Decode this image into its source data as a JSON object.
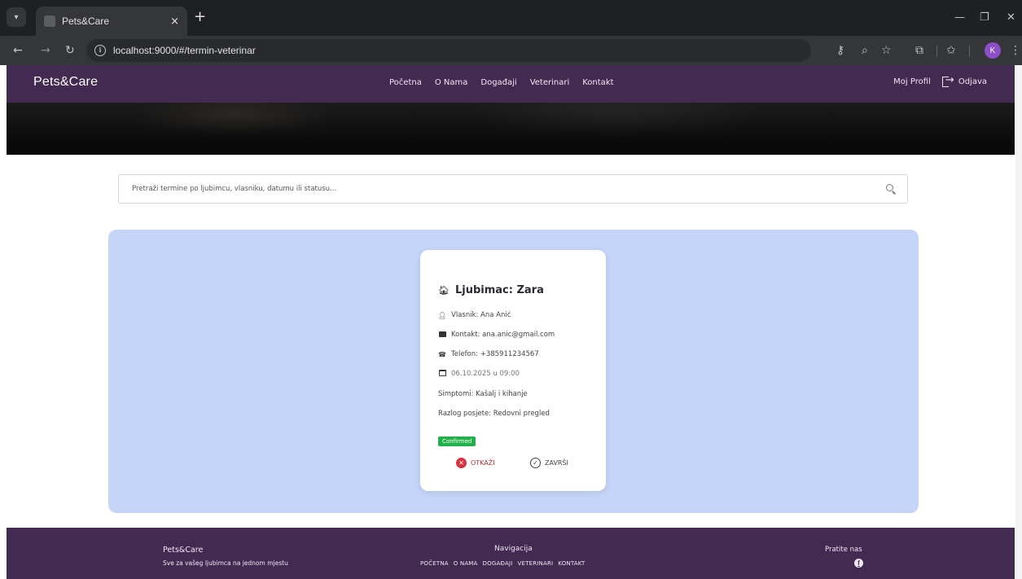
{
  "browser": {
    "tab_title": "Pets&Care",
    "tab_close": "×",
    "new_tab": "+",
    "url": "localhost:9000/#/termin-veterinar",
    "profile_initial": "K"
  },
  "header": {
    "brand": "Pets&Care",
    "nav": [
      "Početna",
      "O Nama",
      "Događaji",
      "Veterinari",
      "Kontakt"
    ],
    "profile_link": "Moj Profil",
    "logout": "Odjava"
  },
  "search": {
    "placeholder": "Pretraži termine po ljubimcu, vlasniku, datumu ili statusu..."
  },
  "appointment": {
    "title": "Ljubimac: Zara",
    "owner": "Vlasnik: Ana Anić",
    "contact": "Kontakt: ana.anic@gmail.com",
    "phone": "Telefon: +385911234567",
    "datetime": "06.10.2025 u 09:00",
    "symptoms": "Simptomi: Kašalj i kihanje",
    "reason": "Razlog posjete: Redovni pregled",
    "status": "Confirmed",
    "status_color": "#23b04a",
    "cancel_label": "OTKAŽI",
    "finish_label": "ZAVRŠI"
  },
  "footer": {
    "brand": "Pets&Care",
    "tagline": "Sve za vašeg ljubimca na jednom mjestu",
    "nav_title": "Navigacija",
    "nav": [
      "POČETNA",
      "O NAMA",
      "DOGAĐAJI",
      "VETERINARI",
      "KONTAKT"
    ],
    "follow": "Pratite nas"
  },
  "colors": {
    "header_bg": "#432a51",
    "panel_bg": "#c5d5f7"
  }
}
